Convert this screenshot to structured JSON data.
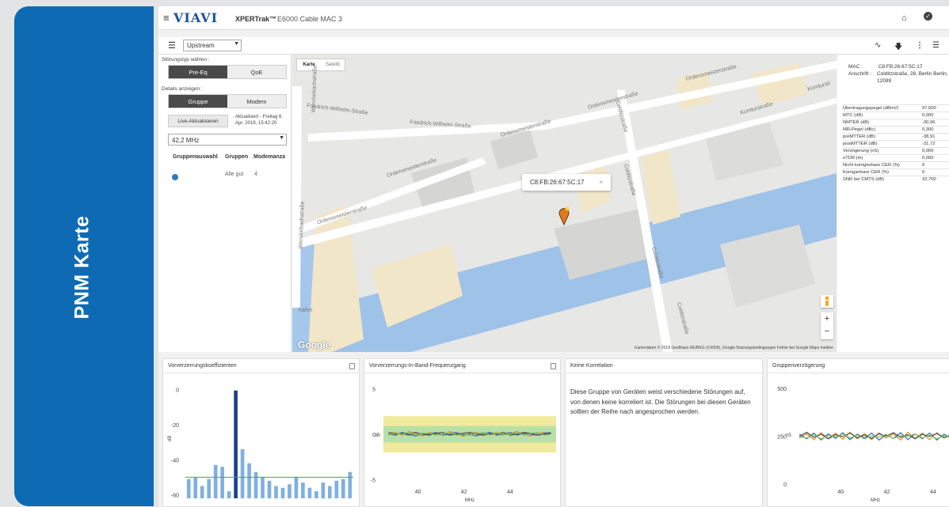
{
  "slide_title": "PNM Karte",
  "header": {
    "menu_glyph": "≡",
    "logo": "VIAVI",
    "product": "XPERTrak™",
    "device": "E6000 Cable MAC 3",
    "home_icon": "home-icon",
    "check_icon": "check-circle-icon"
  },
  "toolbar": {
    "menu_icon": "hamburger-icon",
    "direction": "Upstream",
    "icons": [
      "rss-icon",
      "download-icon",
      "more-vert-icon",
      "list-icon"
    ]
  },
  "left": {
    "stoerungstyp_label": "Störungstyp wählen :",
    "stoerungstyp_options": [
      "Pre-Eq",
      "QoE"
    ],
    "details_label": "Details anzeigen :",
    "details_options": [
      "Gruppe",
      "Modem"
    ],
    "live_button": "Live-Aktualisieren",
    "updated_line1": "Aktualisiert - Freitag 6.",
    "updated_line2": "Apr. 2018, 15:42:20",
    "frequency": "42,2 MHz",
    "table_headers": [
      "Gruppenauswahl",
      "Gruppen",
      "Modemanza"
    ],
    "table_row": {
      "gruppen": "Alle gut",
      "anzahl": "4"
    }
  },
  "map": {
    "tabs": [
      "Karte",
      "Satellit"
    ],
    "streets": [
      "Friedrich-Wilhelm-Straße",
      "Friedrich-Wilhelm-Straße",
      "Ordensmeisterstraße",
      "Ordensmeisterstraße",
      "Ordensmeisterstraße",
      "Ordensmeisterstraße",
      "Ordensmeisterstraße",
      "Colditzstraße",
      "Colditzstraße",
      "Colditzstraße",
      "Colditzstraße",
      "Komturstraße",
      "Komtursti",
      "Wenckebachstraße",
      "Wenckebachstraße"
    ],
    "popup_mac": "C8:FB:26:67:5C:17",
    "close_glyph": "×",
    "attribution": "Kartendaten © 2018 GeoBasis-DE/BKG (©2009), Google   Nutzungsbedingungen   Fehler bei Google Maps melden",
    "google": "Google",
    "zoom_in": "+",
    "zoom_out": "−",
    "hafen": "hafen"
  },
  "details": {
    "mac_label": "MAC :",
    "mac_value": "C8:FB:26:67:5C:17",
    "address_label": "Anschrift :",
    "address_value": "Colditzstraße, 28, Berlin Berlin, 12099",
    "metrics": [
      {
        "name": "Übertragungspegel (dBmV)",
        "value": "97,000"
      },
      {
        "name": "MTC (dB)",
        "value": "0,000"
      },
      {
        "name": "NMTER (dB)",
        "value": "-30,96"
      },
      {
        "name": "MR-Pegel (dBc)",
        "value": "0,300"
      },
      {
        "name": "preMTTER (dB)",
        "value": "-38,91"
      },
      {
        "name": "postMTTER (dB)",
        "value": "-31,72"
      },
      {
        "name": "Verzögerung (nS)",
        "value": "0,000"
      },
      {
        "name": "eTDR (m)",
        "value": "0,000"
      },
      {
        "name": "Nicht korrigierbare CER (%)",
        "value": "0"
      },
      {
        "name": "Korrigierbare CER (%)",
        "value": "0"
      },
      {
        "name": "SNR bei CMTS (dB)",
        "value": "32,700"
      }
    ]
  },
  "cards": {
    "c1": "Vorverzerrungskoeffizienten",
    "c2": "Vorverzerrungs-In-Band-Frequenzgang",
    "c3": "Keine Korrelation",
    "c4": "Gruppenverzögerung",
    "nocorr_text": "Diese Gruppe von Geräten weist verschiedene Störungen auf, von denen keine korreliert ist. Die Störungen bei diesen Geräten sollten der Reihe nach angesprochen werden."
  },
  "chart_data": [
    {
      "type": "bar",
      "title": "Vorverzerrungskoeffizienten",
      "ylabel": "dB",
      "ylim": [
        -62,
        3
      ],
      "yticks": [
        0,
        -20,
        -40,
        -60
      ],
      "values": [
        -51,
        -50,
        -55,
        -51,
        -43,
        -44,
        -58,
        -0.5,
        -34,
        -42,
        -47,
        -50,
        -52,
        -55,
        -56,
        -54,
        -50,
        -53,
        -56,
        -58,
        -53,
        -55,
        -52,
        -51,
        -47
      ],
      "highlight_index": 7,
      "reference_line": -50,
      "colors": {
        "bar": "#7fb0e0",
        "highlight": "#1d3f8f",
        "line": "#5aa04a"
      }
    },
    {
      "type": "line",
      "title": "Vorverzerrungs-In-Band-Frequenzgang",
      "xlabel": "MHz",
      "ylabel": "dB",
      "xlim": [
        38.5,
        46
      ],
      "ylim": [
        -5.5,
        5.5
      ],
      "xticks": [
        40,
        42,
        44
      ],
      "yticks": [
        5,
        0,
        -5
      ],
      "bands": [
        {
          "from": -2,
          "to": 2,
          "color": "#f0ea9c"
        },
        {
          "from": -0.9,
          "to": 0.9,
          "color": "#b9dfa8"
        }
      ],
      "series": [
        {
          "color": "#e08a2a",
          "values": [
            0.1,
            0.2,
            -0.1,
            0.3,
            0.1,
            -0.2,
            0.2,
            0.0,
            -0.1,
            0.3,
            0.1,
            -0.2,
            0.1,
            0.2,
            -0.1,
            0.0,
            0.2,
            -0.1,
            0.1,
            0.3,
            0.0,
            -0.2,
            0.1,
            0.2,
            0.0
          ]
        },
        {
          "color": "#3a6fb0",
          "values": [
            0.0,
            -0.1,
            0.2,
            0.0,
            -0.2,
            0.1,
            0.0,
            0.2,
            -0.1,
            0.0,
            0.2,
            -0.1,
            0.0,
            -0.2,
            0.1,
            0.2,
            -0.1,
            0.0,
            0.2,
            -0.1,
            0.1,
            0.0,
            -0.1,
            0.1,
            0.2
          ]
        },
        {
          "color": "#4a4a4a",
          "values": [
            0.2,
            0.0,
            0.1,
            -0.1,
            0.2,
            0.0,
            -0.1,
            0.1,
            0.2,
            -0.1,
            0.0,
            0.1,
            0.2,
            0.0,
            -0.1,
            0.1,
            0.0,
            0.2,
            -0.1,
            0.0,
            0.2,
            0.1,
            -0.1,
            0.0,
            0.1
          ]
        },
        {
          "color": "#7cbf5c",
          "values": [
            -0.1,
            0.1,
            0.0,
            0.2,
            -0.1,
            0.1,
            0.1,
            -0.1,
            0.0,
            0.2,
            -0.1,
            0.0,
            -0.1,
            0.1,
            0.2,
            -0.1,
            0.1,
            0.0,
            0.0,
            0.2,
            -0.1,
            0.1,
            0.2,
            -0.1,
            0.0
          ]
        }
      ]
    },
    {
      "type": "line",
      "title": "Gruppenverzögerung",
      "xlabel": "MHz",
      "ylabel": "nS",
      "xlim": [
        38,
        45
      ],
      "ylim": [
        0,
        520
      ],
      "xticks": [
        40,
        42,
        44
      ],
      "yticks": [
        500,
        250,
        0
      ],
      "series": [
        {
          "color": "#e08a2a",
          "values": [
            240,
            262,
            232,
            268,
            238,
            266,
            234,
            270,
            236,
            264,
            232,
            268,
            240,
            262,
            230,
            270,
            238,
            266,
            232,
            268,
            240,
            262
          ]
        },
        {
          "color": "#3a6fb0",
          "values": [
            260,
            236,
            266,
            230,
            262,
            238,
            268,
            232,
            260,
            240,
            266,
            230,
            258,
            238,
            268,
            232,
            262,
            236,
            266,
            230,
            260,
            238
          ]
        },
        {
          "color": "#4a4a4a",
          "values": [
            250,
            270,
            244,
            260,
            236,
            258,
            248,
            266,
            242,
            256,
            238,
            262,
            250,
            268,
            244,
            258,
            236,
            260,
            248,
            264,
            242,
            254
          ]
        },
        {
          "color": "#7cbf5c",
          "values": [
            248,
            240,
            258,
            236,
            254,
            246,
            262,
            240,
            256,
            236,
            252,
            244,
            260,
            238,
            254,
            248,
            262,
            240,
            256,
            236,
            252,
            246
          ]
        }
      ]
    }
  ]
}
